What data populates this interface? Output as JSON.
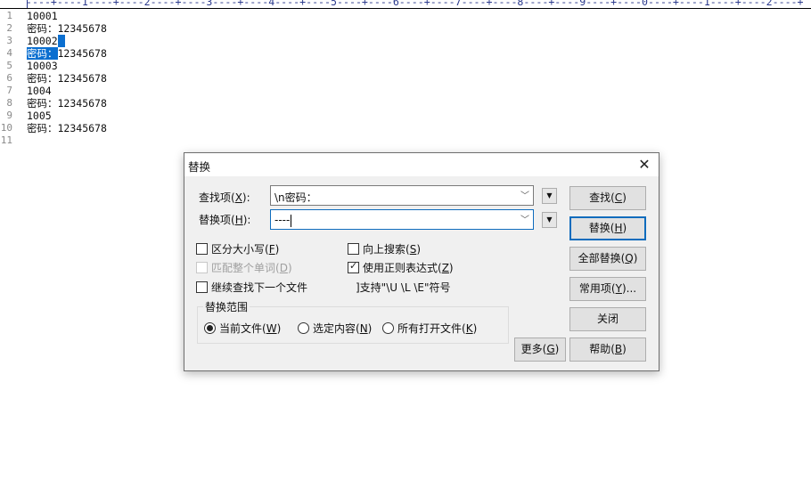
{
  "ruler": {
    "text": "----+----1----+----2----+----3----+----4----+----5----+----6----+----7----+----8----+----9----+----0----+----1----+----2----+"
  },
  "editor": {
    "lines": [
      {
        "num": "1",
        "text": "10001"
      },
      {
        "num": "2",
        "text": "密码：12345678"
      },
      {
        "num": "3",
        "text": "10002",
        "selected": true
      },
      {
        "num": "4",
        "selected_prefix": "密码：",
        "text": "12345678"
      },
      {
        "num": "5",
        "text": "10003"
      },
      {
        "num": "6",
        "text": "密码：12345678"
      },
      {
        "num": "7",
        "text": "1004"
      },
      {
        "num": "8",
        "text": "密码：12345678"
      },
      {
        "num": "9",
        "text": "1005"
      },
      {
        "num": "10",
        "text": "密码：12345678"
      },
      {
        "num": "11",
        "text": ""
      }
    ],
    "selection_color": "#0b6fd0"
  },
  "dialog": {
    "title": "替换",
    "close_icon": "close-icon",
    "find_label": "查找项(",
    "find_key": "X",
    "find_label_end": "):",
    "find_value": "\\n密码：",
    "replace_label": "替换项(",
    "replace_key": "H",
    "replace_label_end": "):",
    "replace_value": "----",
    "options": {
      "match_case": {
        "label": "区分大小写(",
        "key": "F",
        "end": ")",
        "checked": false
      },
      "whole_word": {
        "label": "匹配整个单词(",
        "key": "D",
        "end": ")",
        "checked": false,
        "disabled": true
      },
      "continue_next_file": {
        "label": "继续查找下一个文件",
        "checked": false
      },
      "search_up": {
        "label": "向上搜索(",
        "key": "S",
        "end": ")",
        "checked": false
      },
      "use_regex": {
        "label": "使用正则表达式(",
        "key": "Z",
        "end": ")",
        "checked": true
      },
      "support_note": "]支持\"\\U \\L \\E\"符号"
    },
    "scope": {
      "title": "替换范围",
      "options": [
        {
          "label": "当前文件(",
          "key": "W",
          "end": ")",
          "selected": true
        },
        {
          "label": "选定内容(",
          "key": "N",
          "end": ")",
          "selected": false
        },
        {
          "label": "所有打开文件(",
          "key": "K",
          "end": ")",
          "selected": false
        }
      ]
    },
    "buttons": {
      "find": {
        "label": "查找(",
        "key": "C",
        "end": ")"
      },
      "replace": {
        "label": "替换(",
        "key": "H",
        "end": ")"
      },
      "replace_all": {
        "label": "全部替换(",
        "key": "Q",
        "end": ")"
      },
      "common": {
        "label": "常用项(",
        "key": "Y",
        "end": ")..."
      },
      "close": {
        "label": "关闭"
      },
      "help": {
        "label": "帮助(",
        "key": "B",
        "end": ")"
      },
      "more": {
        "label": "更多(",
        "key": "G",
        "end": ")"
      }
    },
    "accent": "#0f6cbd"
  }
}
